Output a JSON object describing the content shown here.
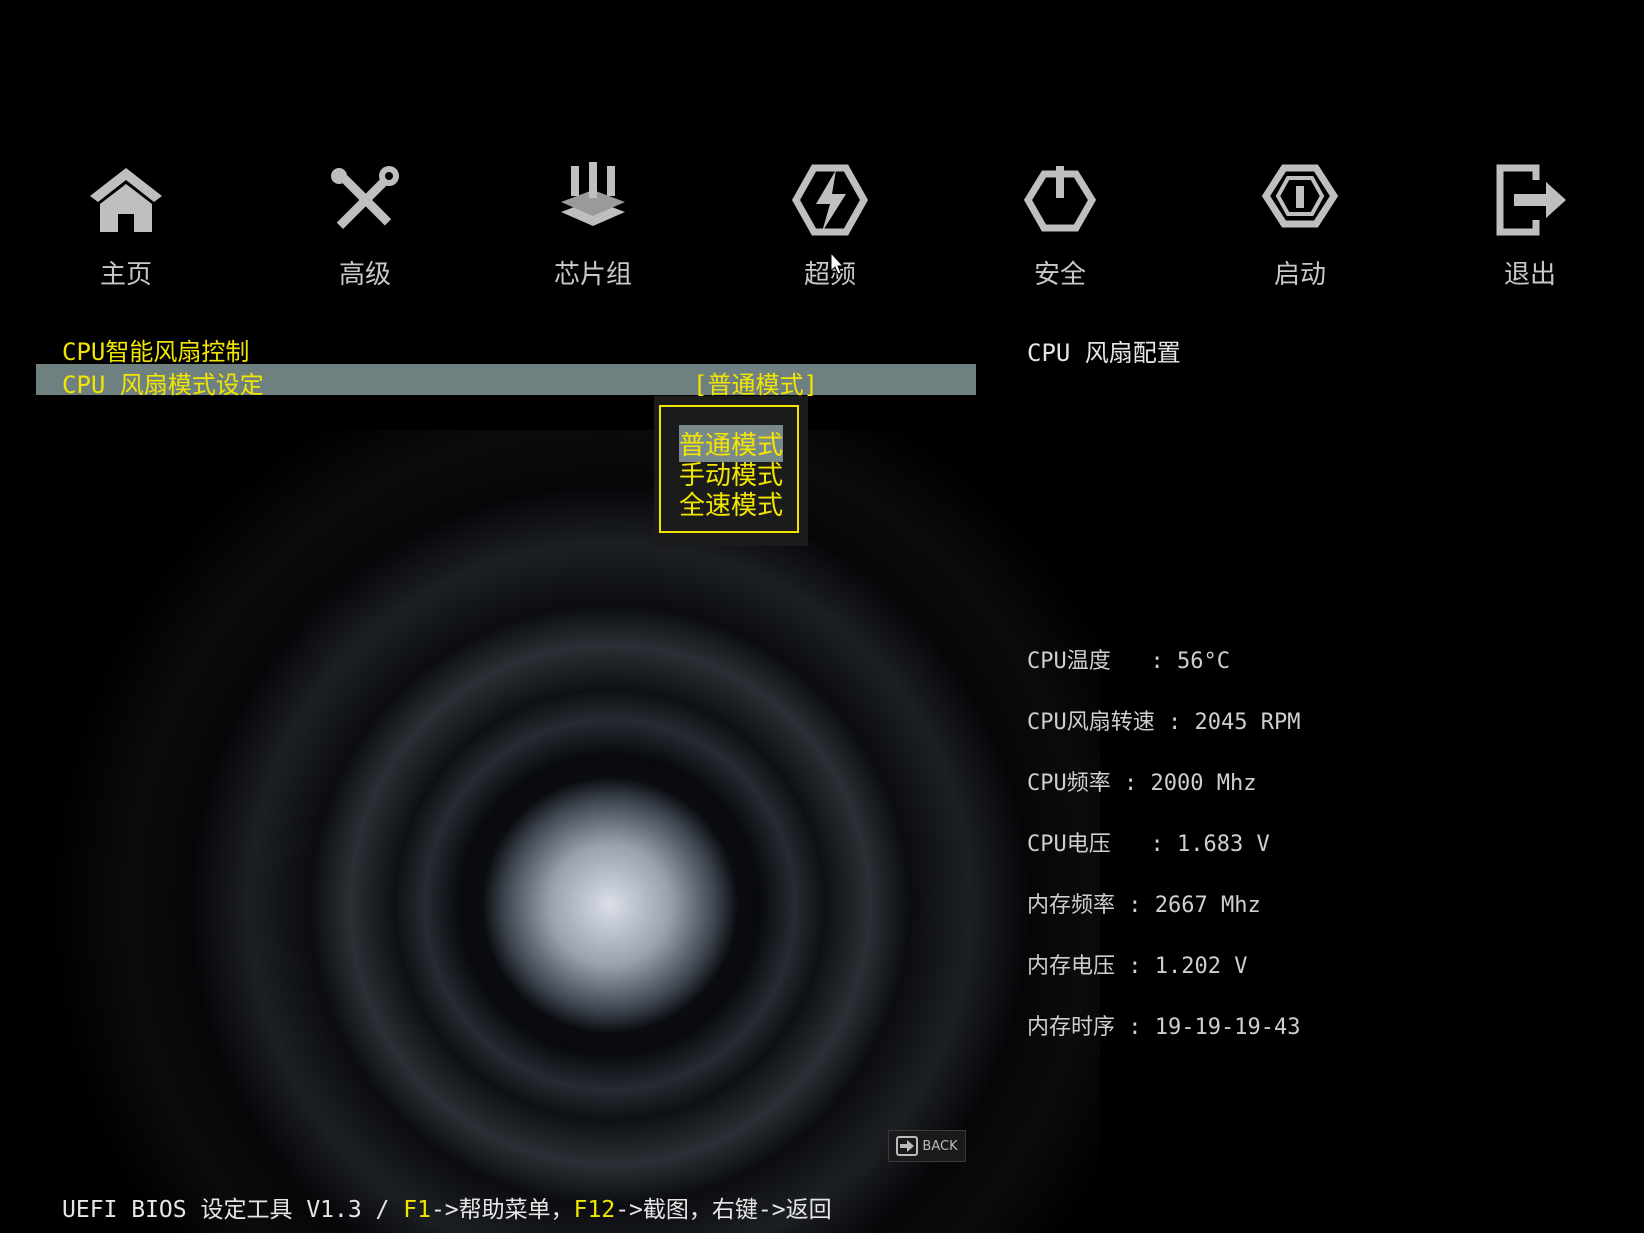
{
  "nav": [
    {
      "label": "主页",
      "icon": "home-icon"
    },
    {
      "label": "高级",
      "icon": "tools-icon"
    },
    {
      "label": "芯片组",
      "icon": "chipset-icon"
    },
    {
      "label": "超频",
      "icon": "overclock-icon"
    },
    {
      "label": "安全",
      "icon": "power-icon"
    },
    {
      "label": "启动",
      "icon": "boot-icon"
    },
    {
      "label": "退出",
      "icon": "exit-icon"
    }
  ],
  "menu": {
    "section_title": "CPU智能风扇控制",
    "item_label": "CPU 风扇模式设定",
    "item_value": "[普通模式]"
  },
  "dropdown": {
    "options": [
      "普通模式",
      "手动模式",
      "全速模式"
    ],
    "selected": "普通模式"
  },
  "help": {
    "title": "CPU 风扇配置"
  },
  "info": [
    {
      "label": "CPU温度  ",
      "value": "56°C"
    },
    {
      "label": "CPU风扇转速",
      "value": "2045 RPM"
    },
    {
      "label": "CPU频率",
      "value": "2000 Mhz"
    },
    {
      "label": "CPU电压  ",
      "value": "1.683 V"
    },
    {
      "label": "内存频率",
      "value": "2667 Mhz"
    },
    {
      "label": "内存电压",
      "value": "1.202 V"
    },
    {
      "label": "内存时序",
      "value": "19-19-19-43"
    }
  ],
  "back_label": "BACK",
  "footer": {
    "prefix": "UEFI BIOS 设定工具 V1.3 / ",
    "key1": "F1",
    "text1": "->帮助菜单，",
    "key2": "F12",
    "text2": "->截图，右键->返回"
  }
}
